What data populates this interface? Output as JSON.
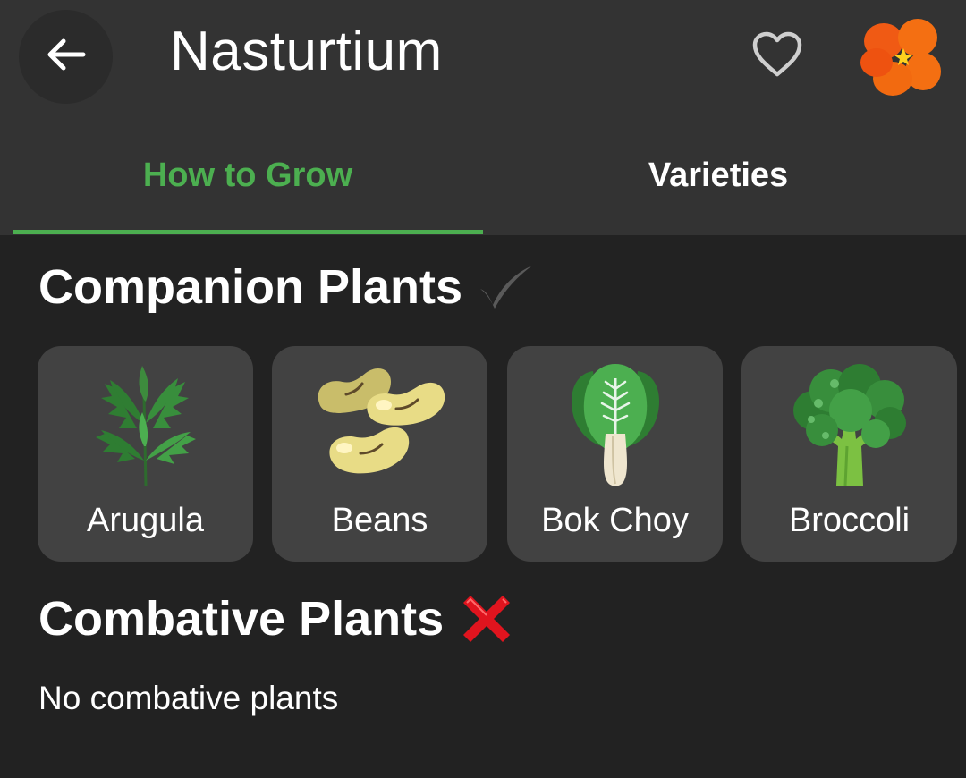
{
  "header": {
    "title": "Nasturtium",
    "back_icon": "arrow-left-icon",
    "favorite_icon": "heart-outline-icon",
    "avatar_icon": "nasturtium-flower-icon"
  },
  "tabs": [
    {
      "label": "How to Grow",
      "active": true
    },
    {
      "label": "Varieties",
      "active": false
    }
  ],
  "companion": {
    "title": "Companion Plants",
    "icon": "checkmark-icon",
    "plants": [
      {
        "name": "Arugula",
        "icon": "arugula-icon"
      },
      {
        "name": "Beans",
        "icon": "beans-icon"
      },
      {
        "name": "Bok Choy",
        "icon": "bok-choy-icon"
      },
      {
        "name": "Broccoli",
        "icon": "broccoli-icon"
      }
    ]
  },
  "combative": {
    "title": "Combative Plants",
    "icon": "cross-mark-icon",
    "empty_text": "No combative plants"
  },
  "colors": {
    "accent": "#4caf50",
    "background": "#222222",
    "toolbar": "#333333",
    "card": "#424242"
  }
}
